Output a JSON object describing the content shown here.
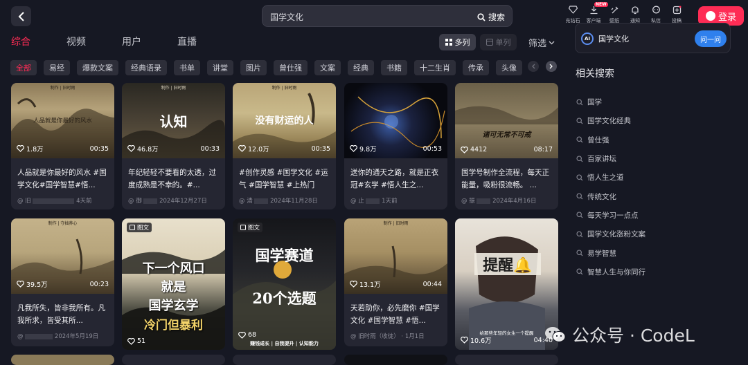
{
  "search": {
    "query": "国学文化",
    "button_label": "搜索"
  },
  "toolbar": {
    "items": [
      {
        "label": "充钻石",
        "icon": "diamond-icon"
      },
      {
        "label": "客户端",
        "icon": "download-icon",
        "badge": "NEW"
      },
      {
        "label": "壁纸",
        "icon": "wallpaper-icon"
      },
      {
        "label": "通知",
        "icon": "bell-icon"
      },
      {
        "label": "私信",
        "icon": "message-icon"
      },
      {
        "label": "投稿",
        "icon": "upload-icon"
      }
    ],
    "login_label": "登录"
  },
  "tabs": [
    {
      "label": "综合",
      "active": true
    },
    {
      "label": "视频"
    },
    {
      "label": "用户"
    },
    {
      "label": "直播"
    }
  ],
  "view": {
    "multi_label": "多列",
    "single_label": "单列",
    "filter_label": "筛选"
  },
  "chips": [
    "全部",
    "易经",
    "爆款文案",
    "经典语录",
    "书单",
    "讲堂",
    "图片",
    "曾仕强",
    "文案",
    "经典",
    "书籍",
    "十二生肖",
    "传承",
    "头像"
  ],
  "cards": [
    {
      "likes": "1.8万",
      "duration": "00:35",
      "caption": "人品就是你最好的风水 #国学文化#国学智慧#悟...",
      "author": "@ 旧",
      "time": "4天前",
      "thumb_text": "人品就是你最好的风水",
      "top_text": "制作 | 旧时雨"
    },
    {
      "likes": "46.8万",
      "duration": "00:33",
      "caption": "年纪轻轻不要看的太透，过度成熟是不幸的。#...",
      "author": "@ 御",
      "time": "2024年12月27日",
      "thumb_text": "认知",
      "top_text": "制作 | 旧时雨"
    },
    {
      "likes": "12.0万",
      "duration": "00:35",
      "caption": "#创作灵感 #国学文化 #运气 #国学智慧 #上热门",
      "author": "@ 清",
      "time": "2024年11月28日",
      "thumb_text": "没有财运的人",
      "top_text": "制作 | 旧时雨"
    },
    {
      "likes": "9.8万",
      "duration": "00:53",
      "caption": "送你的通天之路，就是正衣冠#玄学 #悟人生之...",
      "author": "@ 止",
      "time": "1天前",
      "thumb_text": "",
      "top_text": ""
    },
    {
      "likes": "4412",
      "duration": "08:17",
      "caption": "国学号制作全流程，每天正能量，吸粉很流畅。 ...",
      "author": "@ 振",
      "time": "2024年4月16日",
      "thumb_text": "诸可无常不可戒",
      "top_text": ""
    },
    {
      "likes": "39.5万",
      "duration": "00:23",
      "caption": "凡我所失，皆非我所有。凡我所求，皆受其所...",
      "author": "@ ",
      "time": "2024年5月19日",
      "thumb_text": "",
      "top_text": "制作 | 守拙养心"
    },
    {
      "likes": "51",
      "duration": "",
      "caption": "",
      "author": "",
      "time": "",
      "tag": "图文",
      "thumb_lines": [
        "下一个风口",
        "就是",
        "国学玄学",
        "冷门但暴利"
      ]
    },
    {
      "likes": "68",
      "duration": "",
      "caption": "",
      "author": "",
      "time": "",
      "tag": "图文",
      "thumb_lines": [
        "国学赛道",
        "20个选题"
      ],
      "bottom_text": "赚钱成长 | 自我提升 | 认知能力"
    },
    {
      "likes": "13.1万",
      "duration": "00:44",
      "caption": "天若助你，必先磨你 #国学文化 #国学智慧 #悟...",
      "author": "@ 旧时雨（收徒）",
      "time": "1月1日",
      "thumb_text": "",
      "top_text": "制作 | 旧时雨"
    },
    {
      "likes": "10.6万",
      "duration": "04:40",
      "caption": "",
      "author": "",
      "time": "",
      "thumb_text": "提醒🔔",
      "bottom_text": "给那些年轻的女生一个提醒"
    }
  ],
  "ai": {
    "logo": "AI",
    "text": "国学文化",
    "button_label": "问一问"
  },
  "related": {
    "title": "相关搜索",
    "items": [
      "国学",
      "国学文化经典",
      "曾仕强",
      "百家讲坛",
      "悟人生之道",
      "传统文化",
      "每天学习一点点",
      "国学文化涨粉文案",
      "易学智慧",
      "智慧人生与你同行"
    ]
  },
  "watermark": "公众号 · CodeL"
}
